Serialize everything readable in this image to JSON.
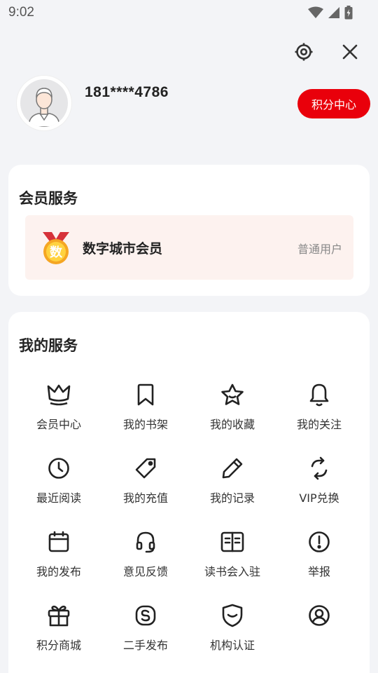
{
  "status_bar": {
    "time": "9:02"
  },
  "profile": {
    "phone": "181****4786",
    "points_button": "积分中心"
  },
  "vip": {
    "title": "会员服务",
    "name": "数字城市会员",
    "level": "普通用户",
    "badge_char": "数"
  },
  "services": {
    "title": "我的服务",
    "items": [
      {
        "label": "会员中心",
        "icon": "crown-icon"
      },
      {
        "label": "我的书架",
        "icon": "bookmark-icon"
      },
      {
        "label": "我的收藏",
        "icon": "star-icon"
      },
      {
        "label": "我的关注",
        "icon": "bell-icon"
      },
      {
        "label": "最近阅读",
        "icon": "clock-icon"
      },
      {
        "label": "我的充值",
        "icon": "tag-icon"
      },
      {
        "label": "我的记录",
        "icon": "pencil-icon"
      },
      {
        "label": "VIP兑换",
        "icon": "refresh-icon"
      },
      {
        "label": "我的发布",
        "icon": "calendar-icon"
      },
      {
        "label": "意见反馈",
        "icon": "headset-icon"
      },
      {
        "label": "读书会入驻",
        "icon": "book-open-icon"
      },
      {
        "label": "举报",
        "icon": "alert-icon"
      },
      {
        "label": "积分商城",
        "icon": "gift-icon"
      },
      {
        "label": "二手发布",
        "icon": "secondhand-icon"
      },
      {
        "label": "机构认证",
        "icon": "shield-check-icon"
      },
      {
        "label": "",
        "icon": "user-circle-icon"
      }
    ]
  },
  "colors": {
    "accent": "#e9000b",
    "background": "#f3f4f7",
    "vip_row_bg": "#fdf2ef"
  }
}
